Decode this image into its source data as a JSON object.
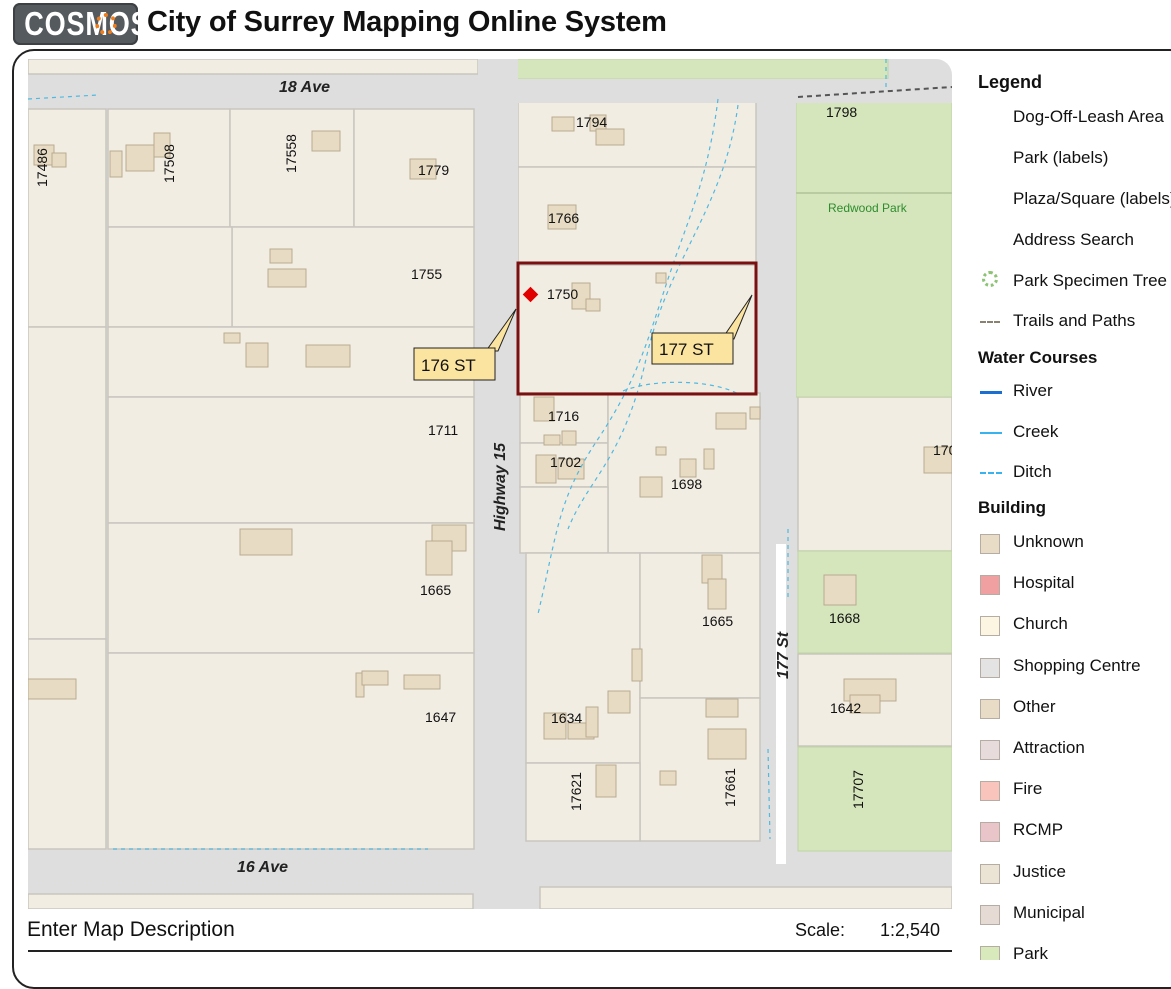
{
  "header": {
    "logo_text": "COSMOS",
    "title": "City of Surrey Mapping Online System"
  },
  "map": {
    "road_labels": {
      "ave_18": "18 Ave",
      "ave_16": "16 Ave",
      "highway_15": "Highway 15",
      "st_177": "177 St"
    },
    "park_label": "Redwood Park",
    "address_labels": [
      "17486",
      "17508",
      "17558",
      "1779",
      "1794",
      "1798",
      "1766",
      "1755",
      "1750",
      "1716",
      "1711",
      "1702",
      "1698",
      "170",
      "1665",
      "1665",
      "1668",
      "1647",
      "1634",
      "1642",
      "17621",
      "17661",
      "17707"
    ],
    "callouts": {
      "left": "176 ST",
      "right": "177 ST"
    },
    "colors": {
      "parcel": "#f2ede3",
      "road": "#dedede",
      "building": "#e7dbc3",
      "park": "#d5e6bc",
      "selection": "#7b1010",
      "marker": "#e00000",
      "ditch": "#4fb9e0"
    }
  },
  "legend": {
    "title": "Legend",
    "items": [
      {
        "label": "Dog-Off-Leash Area",
        "swatch": "none"
      },
      {
        "label": "Park (labels)",
        "swatch": "none"
      },
      {
        "label": "Plaza/Square (labels)",
        "swatch": "none"
      },
      {
        "label": "Address Search",
        "swatch": "none"
      },
      {
        "label": "Park Specimen Tree",
        "swatch": "tree-icon"
      },
      {
        "label": "Trails and Paths",
        "swatch": "dash"
      }
    ],
    "water_title": "Water Courses",
    "water_items": [
      {
        "label": "River",
        "color": "#1a6fd0"
      },
      {
        "label": "Creek",
        "color": "#38b3f0"
      },
      {
        "label": "Ditch",
        "color": "#38b3f0"
      }
    ],
    "building_title": "Building",
    "building_items": [
      {
        "label": "Unknown",
        "color": "#e8dcc6"
      },
      {
        "label": "Hospital",
        "color": "#f0a0a0"
      },
      {
        "label": "Church",
        "color": "#fbf5e2"
      },
      {
        "label": "Shopping Centre",
        "color": "#e3e3e3"
      },
      {
        "label": "Other",
        "color": "#e8dcc6"
      },
      {
        "label": "Attraction",
        "color": "#e8dbdc"
      },
      {
        "label": "Fire",
        "color": "#f8c4bc"
      },
      {
        "label": "RCMP",
        "color": "#e9c4c8"
      },
      {
        "label": "Justice",
        "color": "#ebe3d4"
      },
      {
        "label": "Municipal",
        "color": "#e6dbd4"
      },
      {
        "label": "Park",
        "color": "#d8e9bc"
      }
    ]
  },
  "footer": {
    "description": "Enter Map Description",
    "scale_label": "Scale:",
    "scale_value": "1:2,540"
  }
}
